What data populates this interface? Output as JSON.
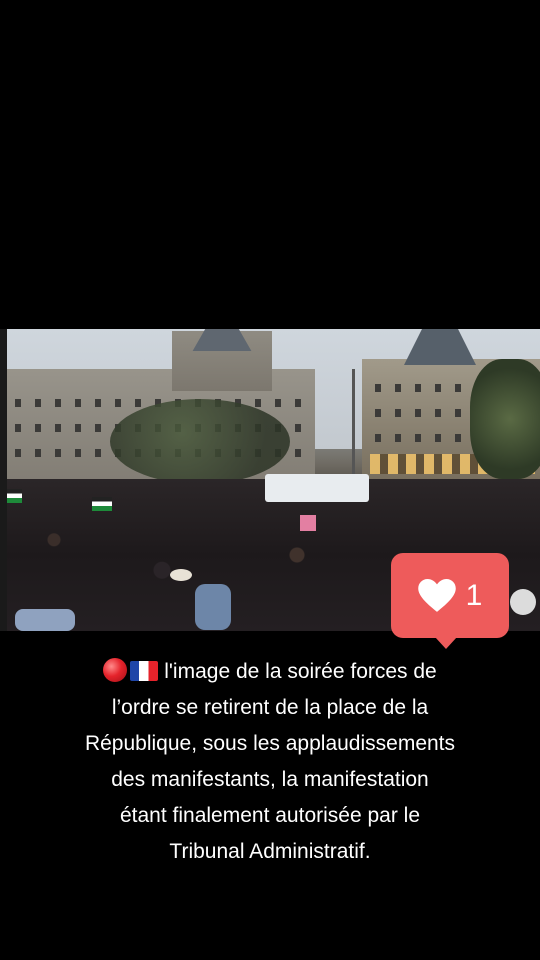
{
  "video": {
    "description_icon": "crowd-video-frame"
  },
  "like_badge": {
    "icon": "heart-icon",
    "count": "1",
    "color": "#ee5b5b"
  },
  "caption": {
    "emoji_1": "red-circle",
    "emoji_2": "france-flag",
    "lines": [
      "l'image de la soirée forces de",
      "l’ordre se retirent de la place de la",
      "République, sous les applaudissements",
      "des manifestants, la manifestation",
      "étant finalement autorisée par le",
      "Tribunal Administratif."
    ]
  }
}
